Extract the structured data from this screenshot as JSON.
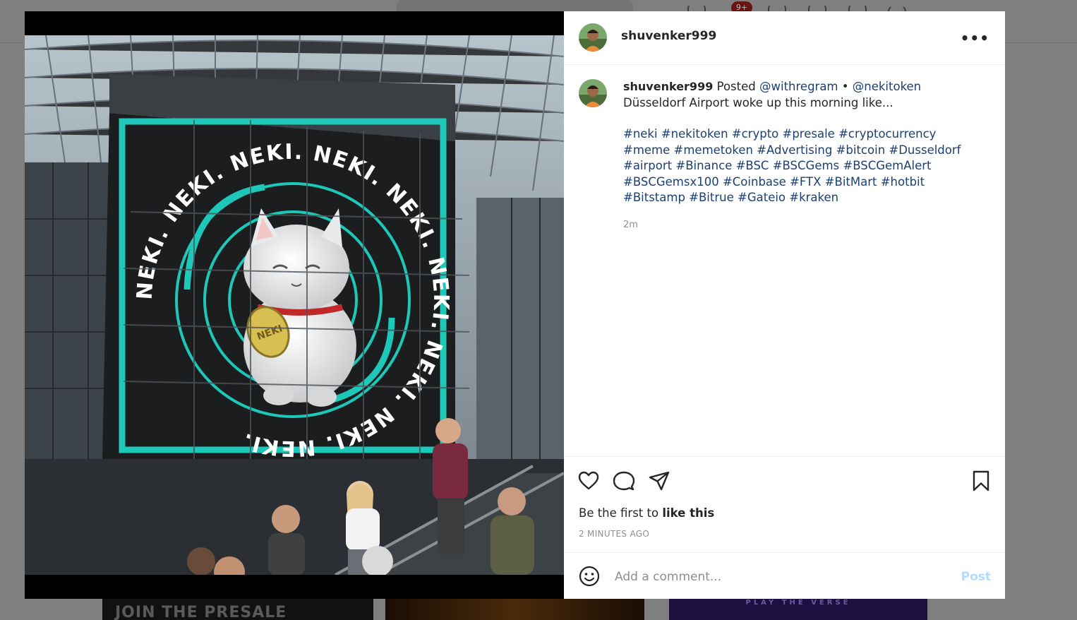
{
  "background": {
    "notification_badge": "9+",
    "card1_text": "JOIN THE PRESALE",
    "card3_text": "PLAY THE VERSE"
  },
  "post": {
    "header": {
      "username": "shuvenker999",
      "more_icon": "more-horizontal-icon"
    },
    "image": {
      "sign_text": "NEKI. NEKI. NEKI. NEKI. NEKI. NEKI. NEKI. NEKI. NEKI.",
      "coin_text": "NEKI",
      "accent_color": "#1ec8b8"
    },
    "caption": {
      "username": "shuvenker999",
      "posted_word": "Posted",
      "mention1": "@withregram",
      "separator": "•",
      "mention2": "@nekitoken",
      "body": "Düsseldorf Airport woke up this morning like...",
      "hashtags": "#neki #nekitoken #crypto #presale #cryptocurrency #meme #memetoken #Advertising #bitcoin #Dusseldorf #airport #Binance #BSC #BSCGems #BSCGemAlert #BSCGemsx100 #Coinbase #FTX #BitMart #hotbit #Bitstamp #Bitrue #Gateio #kraken",
      "time": "2m"
    },
    "actions": {
      "like_icon": "heart-icon",
      "comment_icon": "comment-icon",
      "share_icon": "paper-plane-icon",
      "save_icon": "bookmark-icon",
      "likes_prefix": "Be the first to",
      "likes_link": "like this",
      "timestamp": "2 MINUTES AGO"
    },
    "comment": {
      "emoji_icon": "smiley-icon",
      "placeholder": "Add a comment...",
      "post_label": "Post"
    }
  }
}
